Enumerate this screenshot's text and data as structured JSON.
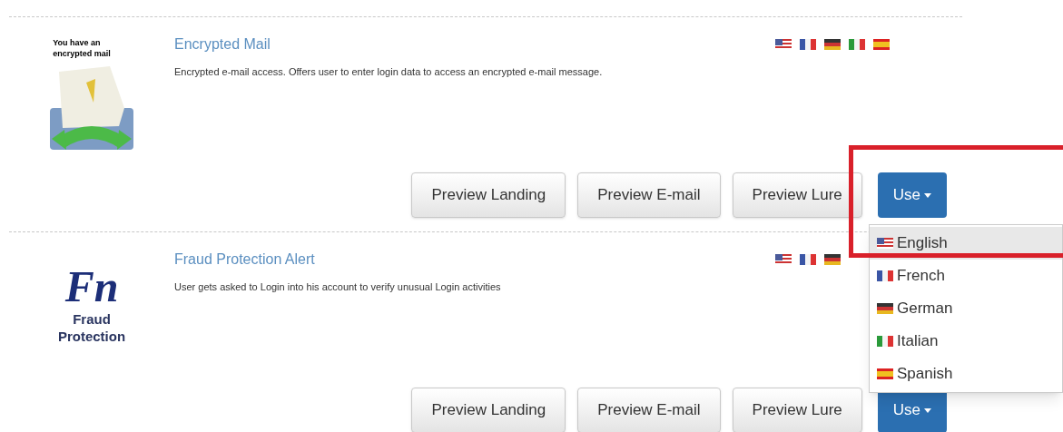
{
  "templates": [
    {
      "logo": {
        "kind": "mail",
        "lines": [
          "You have an",
          "encrypted mail"
        ]
      },
      "title": "Encrypted Mail",
      "flags": [
        {
          "kind": "us"
        },
        {
          "kind": "fr"
        },
        {
          "kind": "de"
        },
        {
          "kind": "it"
        },
        {
          "kind": "es"
        }
      ],
      "description": "Encrypted e-mail access. Offers user to enter login data to access an encrypted e-mail message.",
      "buttons": [
        "Preview Landing",
        "Preview E-mail",
        "Preview Lure"
      ],
      "use_button": "Use"
    },
    {
      "logo": {
        "kind": "monogram",
        "monogram": "Fn",
        "lines": [
          "Fraud",
          "Protection"
        ]
      },
      "title": "Fraud Protection Alert",
      "flags": [
        {
          "kind": "us"
        },
        {
          "kind": "fr"
        },
        {
          "kind": "de"
        }
      ],
      "description": "User gets asked to Login into his account to verify unusual Login activities",
      "buttons": [
        "Preview Landing",
        "Preview E-mail",
        "Preview Lure"
      ],
      "use_button": "Use"
    }
  ],
  "dropdown": {
    "items": [
      {
        "label": "English",
        "selected": true
      },
      {
        "label": "French",
        "selected": false
      },
      {
        "label": "German",
        "selected": false
      },
      {
        "label": "Italian",
        "selected": false
      },
      {
        "label": "Spanish",
        "selected": false
      }
    ]
  }
}
